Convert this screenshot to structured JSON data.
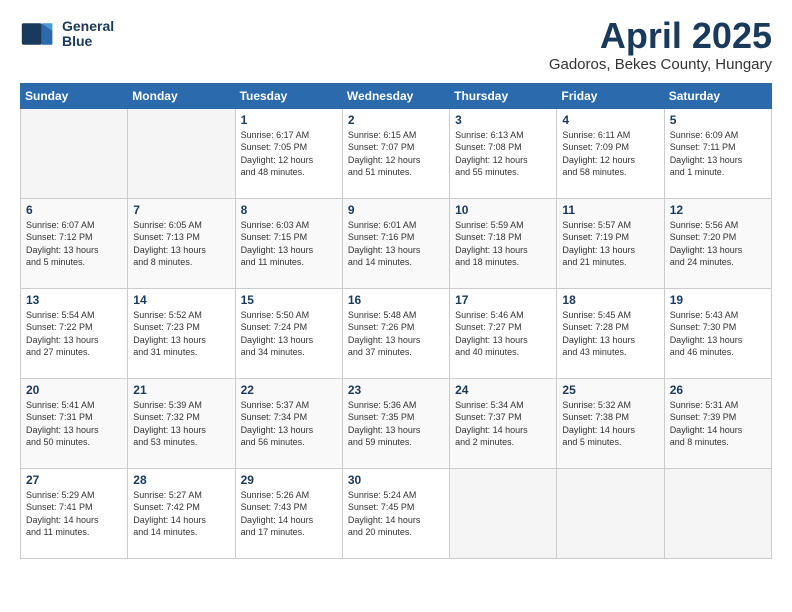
{
  "header": {
    "logo_line1": "General",
    "logo_line2": "Blue",
    "month_title": "April 2025",
    "subtitle": "Gadoros, Bekes County, Hungary"
  },
  "calendar": {
    "days_of_week": [
      "Sunday",
      "Monday",
      "Tuesday",
      "Wednesday",
      "Thursday",
      "Friday",
      "Saturday"
    ],
    "weeks": [
      [
        {
          "day": "",
          "info": ""
        },
        {
          "day": "",
          "info": ""
        },
        {
          "day": "1",
          "info": "Sunrise: 6:17 AM\nSunset: 7:05 PM\nDaylight: 12 hours\nand 48 minutes."
        },
        {
          "day": "2",
          "info": "Sunrise: 6:15 AM\nSunset: 7:07 PM\nDaylight: 12 hours\nand 51 minutes."
        },
        {
          "day": "3",
          "info": "Sunrise: 6:13 AM\nSunset: 7:08 PM\nDaylight: 12 hours\nand 55 minutes."
        },
        {
          "day": "4",
          "info": "Sunrise: 6:11 AM\nSunset: 7:09 PM\nDaylight: 12 hours\nand 58 minutes."
        },
        {
          "day": "5",
          "info": "Sunrise: 6:09 AM\nSunset: 7:11 PM\nDaylight: 13 hours\nand 1 minute."
        }
      ],
      [
        {
          "day": "6",
          "info": "Sunrise: 6:07 AM\nSunset: 7:12 PM\nDaylight: 13 hours\nand 5 minutes."
        },
        {
          "day": "7",
          "info": "Sunrise: 6:05 AM\nSunset: 7:13 PM\nDaylight: 13 hours\nand 8 minutes."
        },
        {
          "day": "8",
          "info": "Sunrise: 6:03 AM\nSunset: 7:15 PM\nDaylight: 13 hours\nand 11 minutes."
        },
        {
          "day": "9",
          "info": "Sunrise: 6:01 AM\nSunset: 7:16 PM\nDaylight: 13 hours\nand 14 minutes."
        },
        {
          "day": "10",
          "info": "Sunrise: 5:59 AM\nSunset: 7:18 PM\nDaylight: 13 hours\nand 18 minutes."
        },
        {
          "day": "11",
          "info": "Sunrise: 5:57 AM\nSunset: 7:19 PM\nDaylight: 13 hours\nand 21 minutes."
        },
        {
          "day": "12",
          "info": "Sunrise: 5:56 AM\nSunset: 7:20 PM\nDaylight: 13 hours\nand 24 minutes."
        }
      ],
      [
        {
          "day": "13",
          "info": "Sunrise: 5:54 AM\nSunset: 7:22 PM\nDaylight: 13 hours\nand 27 minutes."
        },
        {
          "day": "14",
          "info": "Sunrise: 5:52 AM\nSunset: 7:23 PM\nDaylight: 13 hours\nand 31 minutes."
        },
        {
          "day": "15",
          "info": "Sunrise: 5:50 AM\nSunset: 7:24 PM\nDaylight: 13 hours\nand 34 minutes."
        },
        {
          "day": "16",
          "info": "Sunrise: 5:48 AM\nSunset: 7:26 PM\nDaylight: 13 hours\nand 37 minutes."
        },
        {
          "day": "17",
          "info": "Sunrise: 5:46 AM\nSunset: 7:27 PM\nDaylight: 13 hours\nand 40 minutes."
        },
        {
          "day": "18",
          "info": "Sunrise: 5:45 AM\nSunset: 7:28 PM\nDaylight: 13 hours\nand 43 minutes."
        },
        {
          "day": "19",
          "info": "Sunrise: 5:43 AM\nSunset: 7:30 PM\nDaylight: 13 hours\nand 46 minutes."
        }
      ],
      [
        {
          "day": "20",
          "info": "Sunrise: 5:41 AM\nSunset: 7:31 PM\nDaylight: 13 hours\nand 50 minutes."
        },
        {
          "day": "21",
          "info": "Sunrise: 5:39 AM\nSunset: 7:32 PM\nDaylight: 13 hours\nand 53 minutes."
        },
        {
          "day": "22",
          "info": "Sunrise: 5:37 AM\nSunset: 7:34 PM\nDaylight: 13 hours\nand 56 minutes."
        },
        {
          "day": "23",
          "info": "Sunrise: 5:36 AM\nSunset: 7:35 PM\nDaylight: 13 hours\nand 59 minutes."
        },
        {
          "day": "24",
          "info": "Sunrise: 5:34 AM\nSunset: 7:37 PM\nDaylight: 14 hours\nand 2 minutes."
        },
        {
          "day": "25",
          "info": "Sunrise: 5:32 AM\nSunset: 7:38 PM\nDaylight: 14 hours\nand 5 minutes."
        },
        {
          "day": "26",
          "info": "Sunrise: 5:31 AM\nSunset: 7:39 PM\nDaylight: 14 hours\nand 8 minutes."
        }
      ],
      [
        {
          "day": "27",
          "info": "Sunrise: 5:29 AM\nSunset: 7:41 PM\nDaylight: 14 hours\nand 11 minutes."
        },
        {
          "day": "28",
          "info": "Sunrise: 5:27 AM\nSunset: 7:42 PM\nDaylight: 14 hours\nand 14 minutes."
        },
        {
          "day": "29",
          "info": "Sunrise: 5:26 AM\nSunset: 7:43 PM\nDaylight: 14 hours\nand 17 minutes."
        },
        {
          "day": "30",
          "info": "Sunrise: 5:24 AM\nSunset: 7:45 PM\nDaylight: 14 hours\nand 20 minutes."
        },
        {
          "day": "",
          "info": ""
        },
        {
          "day": "",
          "info": ""
        },
        {
          "day": "",
          "info": ""
        }
      ]
    ]
  }
}
